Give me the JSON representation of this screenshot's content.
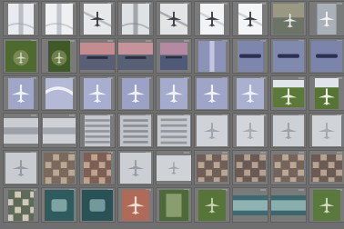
{
  "gallery": {
    "title": "",
    "columns": 9,
    "rows": 6,
    "cell_menu_icon": "more-icon",
    "thumbnails": [
      {
        "kind": "snow-runway",
        "colors": [
          "#e9ebee",
          "#9aa0a8"
        ]
      },
      {
        "kind": "snow-runway",
        "colors": [
          "#eef0f2",
          "#a4a8ae"
        ]
      },
      {
        "kind": "snow-plane",
        "colors": [
          "#e6e8ea",
          "#8c9096"
        ]
      },
      {
        "kind": "snow-runway",
        "colors": [
          "#dfe2e5",
          "#7c8086"
        ]
      },
      {
        "kind": "snow-plane",
        "colors": [
          "#e2e4e6",
          "#6f737a"
        ]
      },
      {
        "kind": "snow-plane",
        "colors": [
          "#f2f3f4",
          "#b0b3b8"
        ]
      },
      {
        "kind": "snow-plane",
        "colors": [
          "#f4f5f6",
          "#a9adb3"
        ]
      },
      {
        "kind": "aerial-tan",
        "colors": [
          "#9a9882",
          "#6b7466"
        ]
      },
      {
        "kind": "aerial-plane-grey",
        "colors": [
          "#8d929a",
          "#c8cdd3"
        ]
      },
      {
        "kind": "grass-plane",
        "colors": [
          "#4e6a2e",
          "#7a8a55"
        ]
      },
      {
        "kind": "grass-plane",
        "colors": [
          "#3f5a26",
          "#6d7f4a"
        ]
      },
      {
        "kind": "sunset",
        "colors": [
          "#c58c8f",
          "#5a5f76"
        ]
      },
      {
        "kind": "sunset",
        "colors": [
          "#c7939a",
          "#586075"
        ]
      },
      {
        "kind": "sunset-ship",
        "colors": [
          "#b38aa1",
          "#4f5a78"
        ]
      },
      {
        "kind": "purple-runway",
        "colors": [
          "#8c93b8",
          "#5f6790"
        ]
      },
      {
        "kind": "purple-ship",
        "colors": [
          "#7d86ac",
          "#4c5580"
        ]
      },
      {
        "kind": "purple-ship",
        "colors": [
          "#808aae",
          "#505b82"
        ]
      },
      {
        "kind": "purple-ship",
        "colors": [
          "#7b84aa",
          "#4a527c"
        ]
      },
      {
        "kind": "purple-plane",
        "colors": [
          "#9fa6c8",
          "#6f76a0"
        ]
      },
      {
        "kind": "purple-snow",
        "colors": [
          "#b4bad6",
          "#7a80a6"
        ]
      },
      {
        "kind": "purple-plane",
        "colors": [
          "#a7aecf",
          "#6d75a0"
        ]
      },
      {
        "kind": "purple-plane",
        "colors": [
          "#9ba2c5",
          "#656d99"
        ]
      },
      {
        "kind": "purple-plane",
        "colors": [
          "#a5abcc",
          "#6a729c"
        ]
      },
      {
        "kind": "purple-plane",
        "colors": [
          "#9ea5c7",
          "#646c98"
        ]
      },
      {
        "kind": "purple-plane",
        "colors": [
          "#a9b0d0",
          "#6c749e"
        ]
      },
      {
        "kind": "grass-white-plane",
        "colors": [
          "#5b7a3a",
          "#e8ece0"
        ]
      },
      {
        "kind": "grass-white-plane",
        "colors": [
          "#567535",
          "#f0f2ea"
        ]
      },
      {
        "kind": "grey-runway",
        "colors": [
          "#c9ccd0",
          "#9da1a7"
        ]
      },
      {
        "kind": "grey-runway",
        "colors": [
          "#cdd0d4",
          "#a3a6ac"
        ]
      },
      {
        "kind": "grey-rows",
        "colors": [
          "#c4c7cb",
          "#8f9399"
        ]
      },
      {
        "kind": "grey-rows",
        "colors": [
          "#c0c3c7",
          "#898d93"
        ]
      },
      {
        "kind": "grey-rows",
        "colors": [
          "#c6c9cd",
          "#93979d"
        ]
      },
      {
        "kind": "grey-plane",
        "colors": [
          "#cfd2d6",
          "#a2a6ac"
        ]
      },
      {
        "kind": "grey-plane",
        "colors": [
          "#d2d5d9",
          "#a9adb2"
        ]
      },
      {
        "kind": "grey-plane",
        "colors": [
          "#cdd0d4",
          "#9fa3a9"
        ]
      },
      {
        "kind": "grey-plane",
        "colors": [
          "#d0d3d7",
          "#a6aaaf"
        ]
      },
      {
        "kind": "grey-plane",
        "colors": [
          "#c8cbcf",
          "#989ca2"
        ]
      },
      {
        "kind": "city",
        "colors": [
          "#7a6a5e",
          "#b9a893"
        ]
      },
      {
        "kind": "city",
        "colors": [
          "#7d5f55",
          "#c0a38c"
        ]
      },
      {
        "kind": "grey-plane",
        "colors": [
          "#cbced2",
          "#9a9ea4"
        ]
      },
      {
        "kind": "grey-plane-small",
        "colors": [
          "#cfd2d6",
          "#a0a4aa"
        ]
      },
      {
        "kind": "city",
        "colors": [
          "#6f5f58",
          "#b8a592"
        ]
      },
      {
        "kind": "city",
        "colors": [
          "#6a5a55",
          "#b3a08f"
        ]
      },
      {
        "kind": "city",
        "colors": [
          "#74645b",
          "#bba795"
        ]
      },
      {
        "kind": "city",
        "colors": [
          "#6b5b54",
          "#b5a290"
        ]
      },
      {
        "kind": "city-harbor",
        "colors": [
          "#5d6b58",
          "#d0c8b8"
        ]
      },
      {
        "kind": "teal-ship",
        "colors": [
          "#2f5a5e",
          "#7ea3a2"
        ]
      },
      {
        "kind": "teal-ship",
        "colors": [
          "#285256",
          "#73999a"
        ]
      },
      {
        "kind": "sunset-plane",
        "colors": [
          "#b06a5a",
          "#e9ddd4"
        ]
      },
      {
        "kind": "green-aerial",
        "colors": [
          "#4e6a3a",
          "#8a9d6e"
        ]
      },
      {
        "kind": "green-plane",
        "colors": [
          "#587539",
          "#c8d0b5"
        ]
      },
      {
        "kind": "teal-water",
        "colors": [
          "#3d6a70",
          "#8fb3b3"
        ]
      },
      {
        "kind": "teal-water",
        "colors": [
          "#3a666c",
          "#89aeae"
        ]
      },
      {
        "kind": "green-plane",
        "colors": [
          "#5a7a3d",
          "#d8dcc8"
        ]
      }
    ],
    "thumb_sizes": [
      [
        28,
        34
      ],
      [
        30,
        34
      ],
      [
        30,
        34
      ],
      [
        30,
        34
      ],
      [
        30,
        34
      ],
      [
        26,
        34
      ],
      [
        26,
        34
      ],
      [
        34,
        34
      ],
      [
        22,
        34
      ],
      [
        34,
        34
      ],
      [
        24,
        34
      ],
      [
        38,
        30
      ],
      [
        38,
        30
      ],
      [
        30,
        30
      ],
      [
        30,
        34
      ],
      [
        28,
        34
      ],
      [
        34,
        34
      ],
      [
        34,
        34
      ],
      [
        28,
        34
      ],
      [
        30,
        34
      ],
      [
        30,
        34
      ],
      [
        30,
        34
      ],
      [
        30,
        34
      ],
      [
        34,
        34
      ],
      [
        30,
        34
      ],
      [
        34,
        30
      ],
      [
        26,
        34
      ],
      [
        38,
        28
      ],
      [
        36,
        28
      ],
      [
        28,
        34
      ],
      [
        34,
        34
      ],
      [
        36,
        34
      ],
      [
        34,
        34
      ],
      [
        30,
        34
      ],
      [
        34,
        34
      ],
      [
        32,
        34
      ],
      [
        34,
        34
      ],
      [
        34,
        34
      ],
      [
        30,
        34
      ],
      [
        34,
        34
      ],
      [
        38,
        28
      ],
      [
        34,
        30
      ],
      [
        34,
        30
      ],
      [
        34,
        30
      ],
      [
        34,
        30
      ],
      [
        28,
        34
      ],
      [
        32,
        34
      ],
      [
        34,
        34
      ],
      [
        30,
        34
      ],
      [
        32,
        34
      ],
      [
        30,
        34
      ],
      [
        38,
        22
      ],
      [
        38,
        22
      ],
      [
        30,
        34
      ]
    ]
  }
}
